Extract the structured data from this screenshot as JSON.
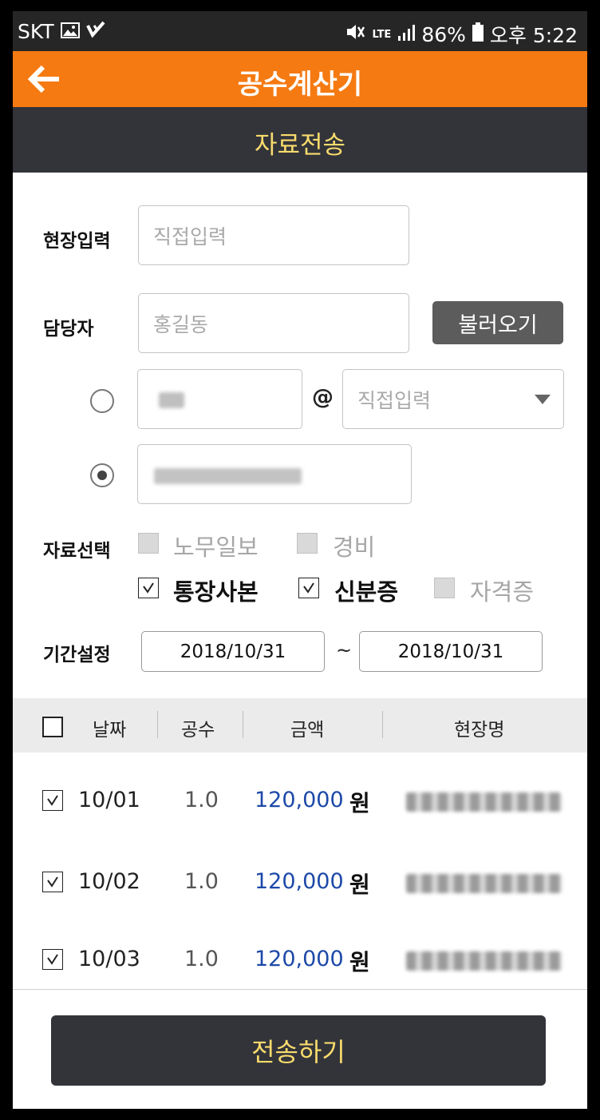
{
  "status_bar": {
    "carrier": "SKT",
    "network": "LTE",
    "battery": "86%",
    "time": "오후 5:22"
  },
  "app_bar": {
    "title": "공수계산기",
    "back_icon": "arrow-left-icon"
  },
  "sub_header": {
    "title": "자료전송"
  },
  "form": {
    "site_label": "현장입력",
    "site_placeholder": "직접입력",
    "manager_label": "담당자",
    "manager_placeholder": "홍길동",
    "load_button": "불러오기",
    "email_at": "@",
    "email_domain_placeholder": "직접입력",
    "email_selected": false,
    "phone_selected": true,
    "data_select_label": "자료선택",
    "options": [
      {
        "label": "노무일보",
        "state": "disabled"
      },
      {
        "label": "경비",
        "state": "disabled"
      },
      {
        "label": "통장사본",
        "state": "checked"
      },
      {
        "label": "신분증",
        "state": "checked"
      },
      {
        "label": "자격증",
        "state": "disabled"
      }
    ],
    "period_label": "기간설정",
    "start_date": "2018/10/31",
    "tilde": "~",
    "end_date": "2018/10/31"
  },
  "table": {
    "headers": [
      "날짜",
      "공수",
      "금액",
      "현장명"
    ],
    "select_all": false,
    "rows": [
      {
        "checked": true,
        "date": "10/01",
        "gongsu": "1.0",
        "amount": "120,000",
        "unit": "원"
      },
      {
        "checked": true,
        "date": "10/02",
        "gongsu": "1.0",
        "amount": "120,000",
        "unit": "원"
      },
      {
        "checked": true,
        "date": "10/03",
        "gongsu": "1.0",
        "amount": "120,000",
        "unit": "원"
      }
    ]
  },
  "footer": {
    "send_button": "전송하기"
  },
  "colors": {
    "app_bar": "#f57a12",
    "dark_header": "#33343a",
    "accent_text": "#f8db6d",
    "amount_blue": "#1d49a8"
  }
}
